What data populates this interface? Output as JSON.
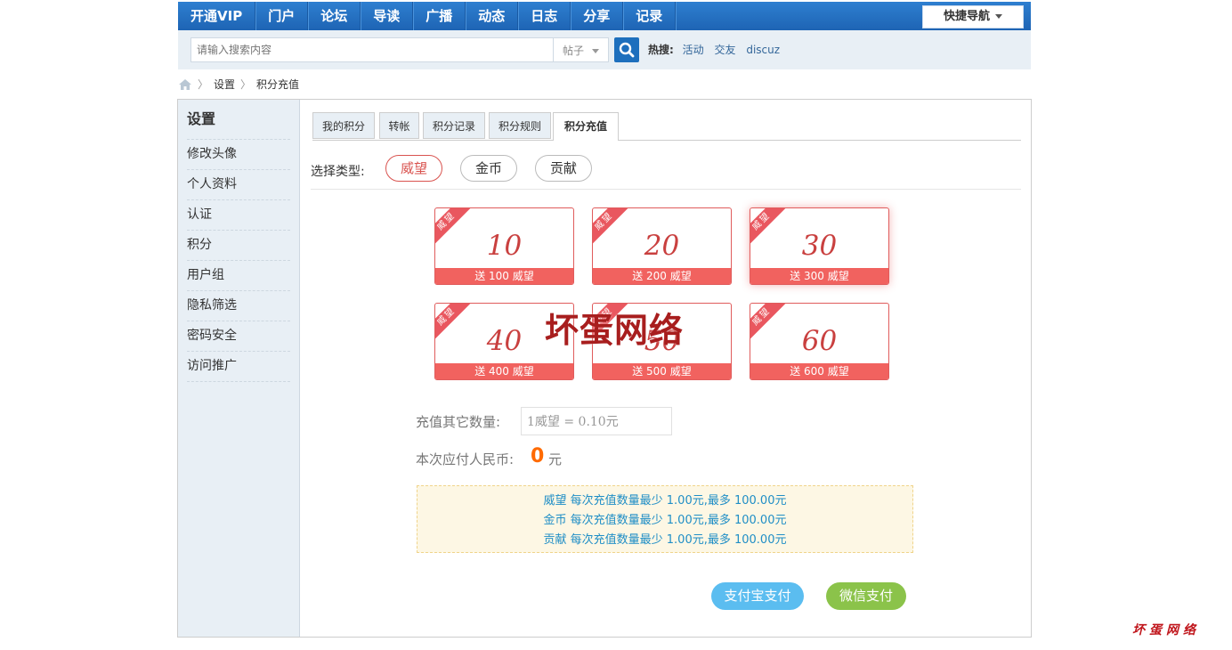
{
  "nav": {
    "items": [
      "开通VIP",
      "门户",
      "论坛",
      "导读",
      "广播",
      "动态",
      "日志",
      "分享",
      "记录"
    ],
    "quick_nav": "快捷导航"
  },
  "search": {
    "placeholder": "请输入搜索内容",
    "type": "帖子",
    "hot_label": "热搜:",
    "hot_items": [
      "活动",
      "交友",
      "discuz"
    ]
  },
  "breadcrumb": [
    "设置",
    "积分充值"
  ],
  "sidebar": {
    "title": "设置",
    "items": [
      "修改头像",
      "个人资料",
      "认证",
      "积分",
      "用户组",
      "隐私筛选",
      "密码安全",
      "访问推广"
    ]
  },
  "tabs": [
    "我的积分",
    "转帐",
    "积分记录",
    "积分规则",
    "积分充值"
  ],
  "active_tab": "积分充值",
  "type_select": {
    "label": "选择类型:",
    "options": [
      "威望",
      "金币",
      "贡献"
    ],
    "selected": "威望"
  },
  "cards": [
    {
      "ribbon": "威望",
      "amount": "10",
      "bonus": "送 100 威望"
    },
    {
      "ribbon": "威望",
      "amount": "20",
      "bonus": "送 200 威望"
    },
    {
      "ribbon": "威望",
      "amount": "30",
      "bonus": "送 300 威望"
    },
    {
      "ribbon": "威望",
      "amount": "40",
      "bonus": "送 400 威望"
    },
    {
      "ribbon": "威望",
      "amount": "50",
      "bonus": "送 500 威望"
    },
    {
      "ribbon": "威望",
      "amount": "60",
      "bonus": "送 600 威望"
    }
  ],
  "watermark": "坏蛋网络",
  "other": {
    "label": "充值其它数量:",
    "placeholder": "1威望 = 0.10元"
  },
  "payment": {
    "label": "本次应付人民币:",
    "amount": "0",
    "unit": "元"
  },
  "notes": [
    "威望 每次充值数量最少 1.00元,最多 100.00元",
    "金币 每次充值数量最少 1.00元,最多 100.00元",
    "贡献 每次充值数量最少 1.00元,最多 100.00元"
  ],
  "buttons": {
    "alipay": "支付宝支付",
    "wechat": "微信支付"
  },
  "corner_watermark": "坏蛋网络",
  "colors": {
    "nav_blue": "#1e64b4",
    "accent_red": "#f1625f",
    "amount_orange": "#ff6a00",
    "alipay_blue": "#5bbdf0",
    "wechat_green": "#8bc34a"
  }
}
